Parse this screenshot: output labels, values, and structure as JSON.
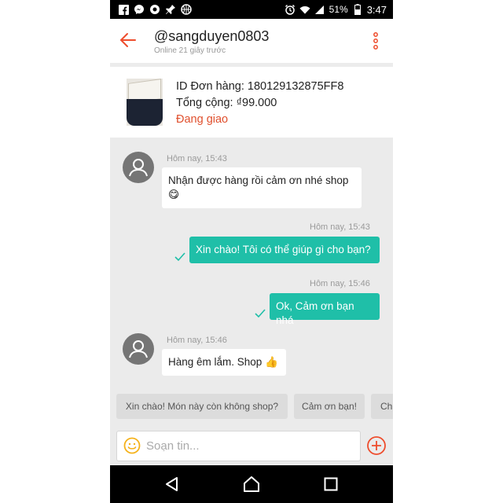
{
  "status_bar": {
    "battery": "51%",
    "time": "3:47",
    "left_icons": [
      "facebook-icon",
      "messenger-icon",
      "app-icon",
      "pin-icon",
      "basketball-icon"
    ],
    "right_icons": [
      "alarm-icon",
      "wifi-icon",
      "signal-icon",
      "battery-icon"
    ]
  },
  "header": {
    "username": "@sangduyen0803",
    "online_status": "Online 21 giây trước"
  },
  "order": {
    "id_line": "ID Đơn hàng: 180129132875FF8",
    "total_line": "Tổng cộng: ₫99.000",
    "status": "Đang giao"
  },
  "messages": [
    {
      "from": "customer",
      "time": "Hôm nay, 15:43",
      "text": "Nhận được hàng rồi cảm ơn nhé shop 😋"
    },
    {
      "from": "shop",
      "time": "Hôm nay, 15:43",
      "text": "Xin chào! Tôi có thể giúp gì cho bạn?"
    },
    {
      "from": "shop",
      "time": "Hôm nay, 15:46",
      "text": "Ok, Cảm ơn bạn nhá"
    },
    {
      "from": "customer",
      "time": "Hôm nay, 15:46",
      "text": "Hàng êm lắm. Shop 👍"
    }
  ],
  "quick_replies": [
    "Xin chào! Món này còn không shop?",
    "Cảm ơn bạn!",
    "Ch"
  ],
  "composer": {
    "placeholder": "Soạn tin..."
  },
  "colors": {
    "accent": "#ee4d2d",
    "bubble_out": "#1fbfa8",
    "chat_bg": "#ebebeb"
  }
}
